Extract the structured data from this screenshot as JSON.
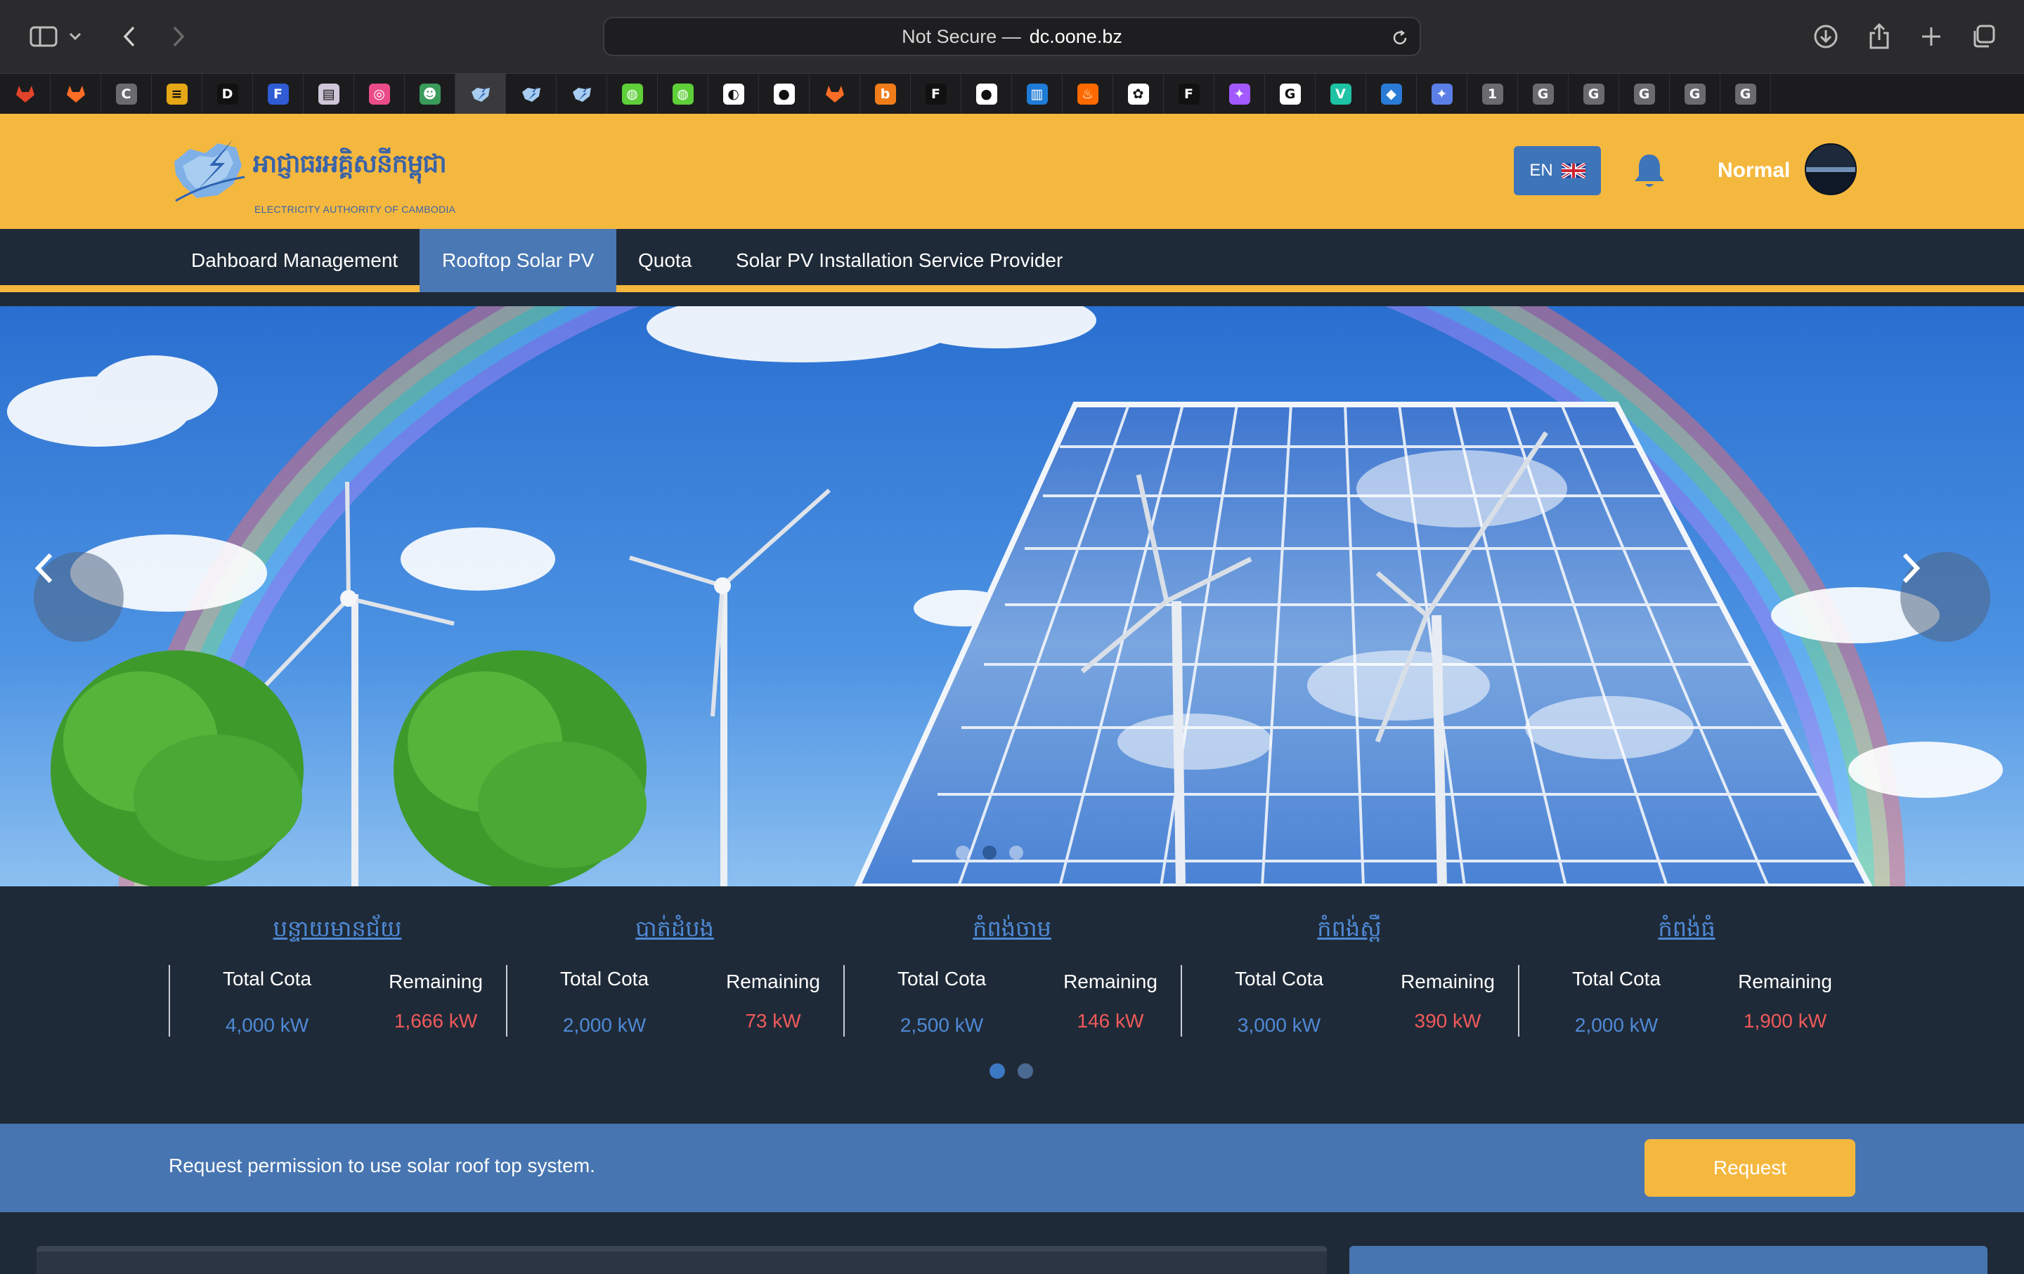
{
  "browser": {
    "address_prefix": "Not Secure —",
    "address_host": "dc.oone.bz",
    "tabs": [
      {
        "icon": "gitlab-icon",
        "letter": "",
        "color": "#e2432a"
      },
      {
        "icon": "gitlab-icon",
        "letter": "",
        "color": "#fc6d26"
      },
      {
        "icon": "c-icon",
        "letter": "C",
        "color": "#6b6b6f"
      },
      {
        "icon": "layers-icon",
        "letter": "≡",
        "color": "#e6a817"
      },
      {
        "icon": "d-icon",
        "letter": "D",
        "color": "#111111"
      },
      {
        "icon": "f-icon",
        "letter": "F",
        "color": "#2f5bd3"
      },
      {
        "icon": "book-icon",
        "letter": "▤",
        "color": "#cfc6d9"
      },
      {
        "icon": "dribbble-icon",
        "letter": "◎",
        "color": "#ea4c89"
      },
      {
        "icon": "robot-icon",
        "letter": "☻",
        "color": "#3a9b5b"
      },
      {
        "icon": "eac-logo-icon",
        "letter": "",
        "color": "#5b8fd0"
      },
      {
        "icon": "eac-logo-icon",
        "letter": "",
        "color": "#5b8fd0"
      },
      {
        "icon": "eac-logo-icon",
        "letter": "",
        "color": "#5b8fd0"
      },
      {
        "icon": "globe-icon",
        "letter": "◍",
        "color": "#5fcf3a"
      },
      {
        "icon": "globe-icon",
        "letter": "◍",
        "color": "#5fcf3a"
      },
      {
        "icon": "planet-icon",
        "letter": "◐",
        "color": "#ffffff"
      },
      {
        "icon": "github-icon",
        "letter": "●",
        "color": "#ffffff"
      },
      {
        "icon": "gitlab-icon",
        "letter": "",
        "color": "#fc6d26"
      },
      {
        "icon": "b-icon",
        "letter": "b",
        "color": "#f07d1a"
      },
      {
        "icon": "figma-icon",
        "letter": "F",
        "color": "#111111"
      },
      {
        "icon": "github-icon",
        "letter": "●",
        "color": "#ffffff"
      },
      {
        "icon": "trello-icon",
        "letter": "▥",
        "color": "#1f7bd8"
      },
      {
        "icon": "fire-icon",
        "letter": "♨",
        "color": "#ff6a00"
      },
      {
        "icon": "openai-icon",
        "letter": "✿",
        "color": "#ffffff"
      },
      {
        "icon": "figma-icon",
        "letter": "F",
        "color": "#111111"
      },
      {
        "icon": "figma-color-icon",
        "letter": "✦",
        "color": "#a259ff"
      },
      {
        "icon": "google-icon",
        "letter": "G",
        "color": "#ffffff"
      },
      {
        "icon": "vuetify-icon",
        "letter": "V",
        "color": "#1dc3a4"
      },
      {
        "icon": "drop-icon",
        "letter": "◆",
        "color": "#2a7bd6"
      },
      {
        "icon": "sparkle-icon",
        "letter": "✦",
        "color": "#5b7fe6"
      },
      {
        "icon": "one-icon",
        "letter": "1",
        "color": "#6b6b6f"
      },
      {
        "icon": "g-icon",
        "letter": "G",
        "color": "#6b6b6f"
      },
      {
        "icon": "g-icon",
        "letter": "G",
        "color": "#6b6b6f"
      },
      {
        "icon": "g-icon",
        "letter": "G",
        "color": "#6b6b6f"
      },
      {
        "icon": "g-icon",
        "letter": "G",
        "color": "#6b6b6f"
      },
      {
        "icon": "g-icon",
        "letter": "G",
        "color": "#6b6b6f"
      }
    ]
  },
  "header": {
    "logo_khmer": "អាជ្ញាធរអគ្គិសនីកម្ពុជា",
    "logo_english": "ELECTRICITY AUTHORITY OF CAMBODIA",
    "lang_label": "EN",
    "flag": "🇬🇧",
    "user_name": "Normal"
  },
  "nav": {
    "items": [
      {
        "label": "Dahboard Management",
        "active": false
      },
      {
        "label": "Rooftop Solar PV",
        "active": true
      },
      {
        "label": "Quota",
        "active": false
      },
      {
        "label": "Solar PV Installation Service Provider",
        "active": false
      }
    ]
  },
  "hero": {
    "slides": 3,
    "active_slide": 2
  },
  "quota": {
    "total_label": "Total Cota",
    "remaining_label": "Remaining",
    "regions": [
      {
        "name": "បន្ទាយមានជ័យ",
        "total": "4,000 kW",
        "remaining": "1,666 kW"
      },
      {
        "name": "បាត់ដំបង",
        "total": "2,000 kW",
        "remaining": "73 kW"
      },
      {
        "name": "កំពង់ចាម",
        "total": "2,500 kW",
        "remaining": "146 kW"
      },
      {
        "name": "កំពង់ស្ពឺ",
        "total": "3,000 kW",
        "remaining": "390 kW"
      },
      {
        "name": "កំពង់ធំ",
        "total": "2,000 kW",
        "remaining": "1,900 kW"
      }
    ],
    "pages": 2,
    "active_page": 1
  },
  "request": {
    "message": "Request permission to use solar roof top system.",
    "button_label": "Request"
  },
  "colors": {
    "brand_yellow": "#f5b83f",
    "brand_blue": "#4775b1",
    "dark_bg": "#1f2a38",
    "total_blue": "#4e8ad6",
    "remaining_red": "#ef5a5a"
  }
}
